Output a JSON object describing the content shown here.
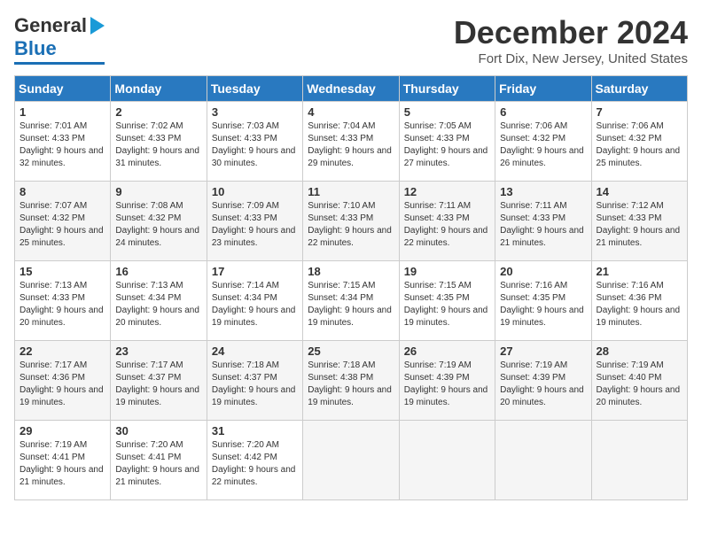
{
  "logo": {
    "text1": "General",
    "text2": "Blue"
  },
  "title": "December 2024",
  "location": "Fort Dix, New Jersey, United States",
  "days_of_week": [
    "Sunday",
    "Monday",
    "Tuesday",
    "Wednesday",
    "Thursday",
    "Friday",
    "Saturday"
  ],
  "weeks": [
    [
      {
        "day": "1",
        "sunrise": "7:01 AM",
        "sunset": "4:33 PM",
        "daylight": "9 hours and 32 minutes."
      },
      {
        "day": "2",
        "sunrise": "7:02 AM",
        "sunset": "4:33 PM",
        "daylight": "9 hours and 31 minutes."
      },
      {
        "day": "3",
        "sunrise": "7:03 AM",
        "sunset": "4:33 PM",
        "daylight": "9 hours and 30 minutes."
      },
      {
        "day": "4",
        "sunrise": "7:04 AM",
        "sunset": "4:33 PM",
        "daylight": "9 hours and 29 minutes."
      },
      {
        "day": "5",
        "sunrise": "7:05 AM",
        "sunset": "4:33 PM",
        "daylight": "9 hours and 27 minutes."
      },
      {
        "day": "6",
        "sunrise": "7:06 AM",
        "sunset": "4:32 PM",
        "daylight": "9 hours and 26 minutes."
      },
      {
        "day": "7",
        "sunrise": "7:06 AM",
        "sunset": "4:32 PM",
        "daylight": "9 hours and 25 minutes."
      }
    ],
    [
      {
        "day": "8",
        "sunrise": "7:07 AM",
        "sunset": "4:32 PM",
        "daylight": "9 hours and 25 minutes."
      },
      {
        "day": "9",
        "sunrise": "7:08 AM",
        "sunset": "4:32 PM",
        "daylight": "9 hours and 24 minutes."
      },
      {
        "day": "10",
        "sunrise": "7:09 AM",
        "sunset": "4:33 PM",
        "daylight": "9 hours and 23 minutes."
      },
      {
        "day": "11",
        "sunrise": "7:10 AM",
        "sunset": "4:33 PM",
        "daylight": "9 hours and 22 minutes."
      },
      {
        "day": "12",
        "sunrise": "7:11 AM",
        "sunset": "4:33 PM",
        "daylight": "9 hours and 22 minutes."
      },
      {
        "day": "13",
        "sunrise": "7:11 AM",
        "sunset": "4:33 PM",
        "daylight": "9 hours and 21 minutes."
      },
      {
        "day": "14",
        "sunrise": "7:12 AM",
        "sunset": "4:33 PM",
        "daylight": "9 hours and 21 minutes."
      }
    ],
    [
      {
        "day": "15",
        "sunrise": "7:13 AM",
        "sunset": "4:33 PM",
        "daylight": "9 hours and 20 minutes."
      },
      {
        "day": "16",
        "sunrise": "7:13 AM",
        "sunset": "4:34 PM",
        "daylight": "9 hours and 20 minutes."
      },
      {
        "day": "17",
        "sunrise": "7:14 AM",
        "sunset": "4:34 PM",
        "daylight": "9 hours and 19 minutes."
      },
      {
        "day": "18",
        "sunrise": "7:15 AM",
        "sunset": "4:34 PM",
        "daylight": "9 hours and 19 minutes."
      },
      {
        "day": "19",
        "sunrise": "7:15 AM",
        "sunset": "4:35 PM",
        "daylight": "9 hours and 19 minutes."
      },
      {
        "day": "20",
        "sunrise": "7:16 AM",
        "sunset": "4:35 PM",
        "daylight": "9 hours and 19 minutes."
      },
      {
        "day": "21",
        "sunrise": "7:16 AM",
        "sunset": "4:36 PM",
        "daylight": "9 hours and 19 minutes."
      }
    ],
    [
      {
        "day": "22",
        "sunrise": "7:17 AM",
        "sunset": "4:36 PM",
        "daylight": "9 hours and 19 minutes."
      },
      {
        "day": "23",
        "sunrise": "7:17 AM",
        "sunset": "4:37 PM",
        "daylight": "9 hours and 19 minutes."
      },
      {
        "day": "24",
        "sunrise": "7:18 AM",
        "sunset": "4:37 PM",
        "daylight": "9 hours and 19 minutes."
      },
      {
        "day": "25",
        "sunrise": "7:18 AM",
        "sunset": "4:38 PM",
        "daylight": "9 hours and 19 minutes."
      },
      {
        "day": "26",
        "sunrise": "7:19 AM",
        "sunset": "4:39 PM",
        "daylight": "9 hours and 19 minutes."
      },
      {
        "day": "27",
        "sunrise": "7:19 AM",
        "sunset": "4:39 PM",
        "daylight": "9 hours and 20 minutes."
      },
      {
        "day": "28",
        "sunrise": "7:19 AM",
        "sunset": "4:40 PM",
        "daylight": "9 hours and 20 minutes."
      }
    ],
    [
      {
        "day": "29",
        "sunrise": "7:19 AM",
        "sunset": "4:41 PM",
        "daylight": "9 hours and 21 minutes."
      },
      {
        "day": "30",
        "sunrise": "7:20 AM",
        "sunset": "4:41 PM",
        "daylight": "9 hours and 21 minutes."
      },
      {
        "day": "31",
        "sunrise": "7:20 AM",
        "sunset": "4:42 PM",
        "daylight": "9 hours and 22 minutes."
      },
      null,
      null,
      null,
      null
    ]
  ],
  "labels": {
    "sunrise": "Sunrise:",
    "sunset": "Sunset:",
    "daylight": "Daylight:"
  }
}
